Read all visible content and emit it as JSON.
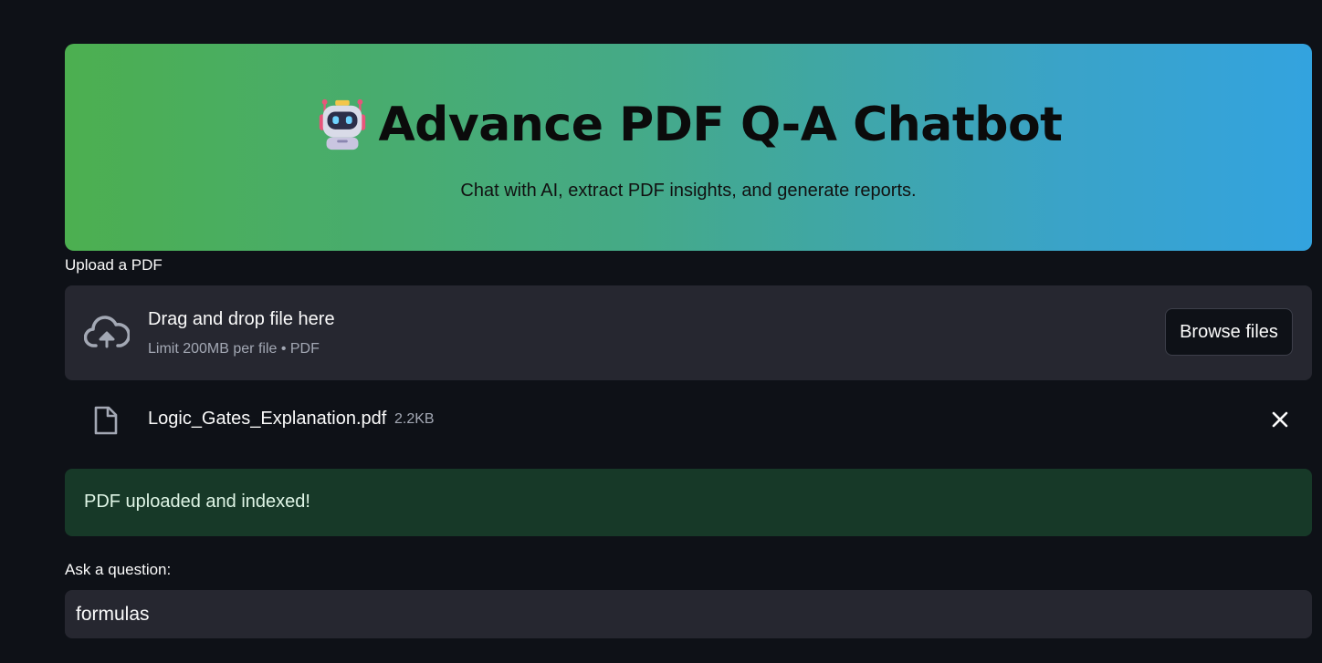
{
  "header": {
    "icon": "robot-icon",
    "title": "Advance PDF Q-A Chatbot",
    "subtitle": "Chat with AI, extract PDF insights, and generate reports.",
    "gradient_start": "#4caf50",
    "gradient_end": "#33a3df"
  },
  "uploader": {
    "label": "Upload a PDF",
    "icon": "cloud-upload-icon",
    "drop_title": "Drag and drop file here",
    "drop_subtitle": "Limit 200MB per file • PDF",
    "browse_label": "Browse files"
  },
  "uploaded_file": {
    "icon": "file-icon",
    "name": "Logic_Gates_Explanation.pdf",
    "size": "2.2KB",
    "remove_icon": "close-icon"
  },
  "status": {
    "message": "PDF uploaded and indexed!",
    "color": "#173928"
  },
  "question": {
    "label": "Ask a question:",
    "value": "formulas"
  },
  "theme": {
    "background": "#0e1117",
    "surface": "#262730"
  }
}
